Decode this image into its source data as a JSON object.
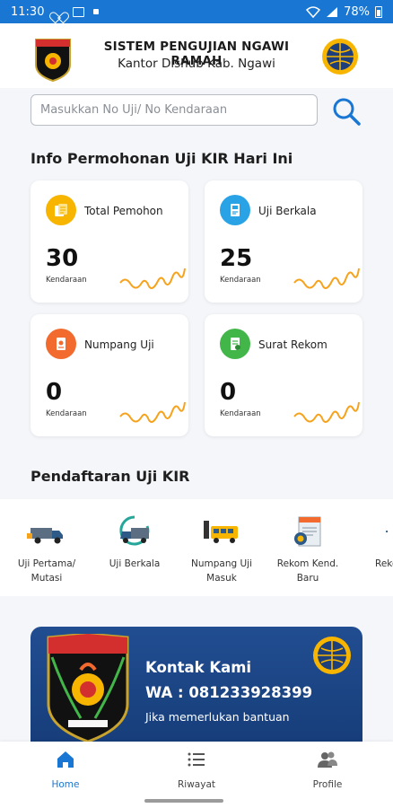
{
  "status_bar": {
    "time": "11:30",
    "battery": "78%"
  },
  "header": {
    "title": "SISTEM PENGUJIAN NGAWI RAMAH",
    "subtitle": "Kantor Dishub Kab. Ngawi"
  },
  "search": {
    "placeholder": "Masukkan No Uji/ No Kendaraan",
    "value": ""
  },
  "info_section": {
    "title": "Info Permohonan Uji KIR Hari Ini",
    "cards": [
      {
        "label": "Total Pemohon",
        "value": "30",
        "unit": "Kendaraan",
        "icon": "document-list-icon",
        "color": "#f7b500"
      },
      {
        "label": "Uji Berkala",
        "value": "25",
        "unit": "Kendaraan",
        "icon": "clipboard-icon",
        "color": "#29a3e6"
      },
      {
        "label": "Numpang Uji",
        "value": "0",
        "unit": "Kendaraan",
        "icon": "document-icon",
        "color": "#f26a2e"
      },
      {
        "label": "Surat Rekom",
        "value": "0",
        "unit": "Kendaraan",
        "icon": "document-check-icon",
        "color": "#43b649"
      }
    ]
  },
  "registration": {
    "title": "Pendaftaran Uji KIR",
    "items": [
      {
        "label_line1": "Uji Pertama/",
        "label_line2": "Mutasi",
        "icon": "truck-icon"
      },
      {
        "label_line1": "Uji Berkala",
        "label_line2": "",
        "icon": "truck-refresh-icon"
      },
      {
        "label_line1": "Numpang Uji",
        "label_line2": "Masuk",
        "icon": "bus-icon"
      },
      {
        "label_line1": "Rekom Kend.",
        "label_line2": "Baru",
        "icon": "certificate-icon"
      },
      {
        "label_line1": "Reko",
        "label_line2": "",
        "icon": "partial-icon"
      }
    ]
  },
  "contact": {
    "title": "Kontak Kami",
    "whatsapp": "WA : 081233928399",
    "help": "Jika memerlukan bantuan"
  },
  "bottom_nav": {
    "items": [
      {
        "label": "Home",
        "icon": "home-icon",
        "active": true
      },
      {
        "label": "Riwayat",
        "icon": "list-icon",
        "active": false
      },
      {
        "label": "Profile",
        "icon": "profile-icon",
        "active": false
      }
    ]
  },
  "colors": {
    "primary": "#1976d2",
    "banner": "#1d4689",
    "sparkline": "#f7a21b"
  }
}
